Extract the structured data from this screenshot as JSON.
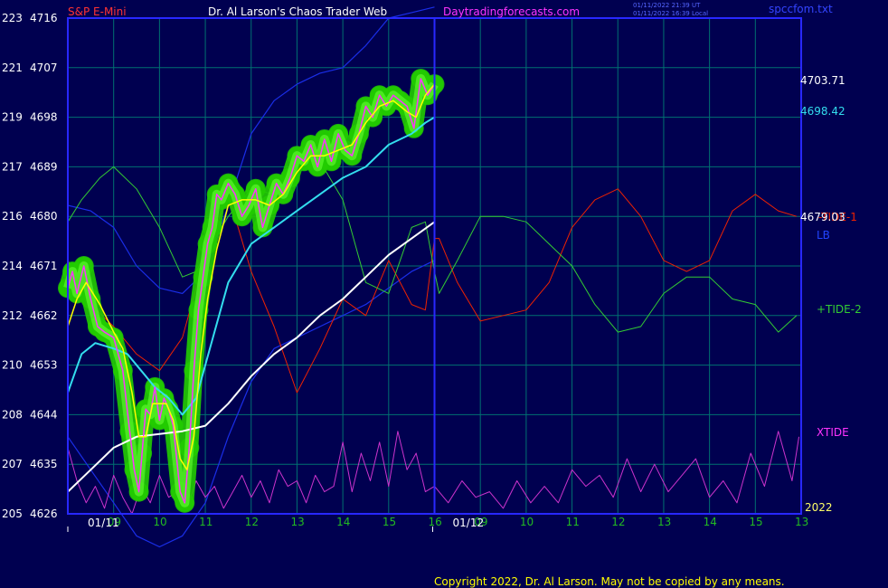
{
  "header": {
    "symbol": "S&P E-Mini",
    "title": "Dr. Al Larson's Chaos Trader Web",
    "site": "Daytradingforecasts.com",
    "utc_time": "01/11/2022 21:39 UT",
    "local_time": "01/11/2022 16:39 Local",
    "file": "spccfom.txt"
  },
  "footer": {
    "copyright": "Copyright 2022, Dr. Al Larson. May not be copied by any means."
  },
  "colors": {
    "background": "#000050",
    "frame": "#2828ff",
    "grid": "#007070",
    "price": "#ff33ff",
    "ma_fast": "#ffff00",
    "ma_mid": "#33ddee",
    "ma_slow": "#ffffff",
    "band": "#1a2ee8",
    "tide1": "#ee2200",
    "tide2": "#33cc33",
    "xtide": "#cc33cc",
    "halo": "#22cc00"
  },
  "chart_data": {
    "type": "line",
    "y_axis": {
      "left_ticks": [
        {
          "a": "223",
          "p": 4716
        },
        {
          "a": "221",
          "p": 4707
        },
        {
          "a": "219",
          "p": 4698
        },
        {
          "a": "217",
          "p": 4689
        },
        {
          "a": "216",
          "p": 4680
        },
        {
          "a": "214",
          "p": 4671
        },
        {
          "a": "212",
          "p": 4662
        },
        {
          "a": "210",
          "p": 4653
        },
        {
          "a": "208",
          "p": 4644
        },
        {
          "a": "207",
          "p": 4635
        },
        {
          "a": "205",
          "p": 4626
        }
      ],
      "ylim": [
        4626,
        4716
      ]
    },
    "x_axis": {
      "hour_labels": [
        "09",
        "10",
        "11",
        "12",
        "13",
        "14",
        "15",
        "16",
        "09",
        "10",
        "11",
        "12",
        "13",
        "14",
        "15",
        "13"
      ],
      "date_labels": [
        "01/11",
        "01/12"
      ],
      "right_corner_label": "2022",
      "hour_index_range": [
        8,
        24
      ],
      "day_separator_index": 16
    },
    "right_labels": {
      "price_last": "4703.71",
      "ma_mid_last": "4698.42",
      "ma_slow_last": "4679.03",
      "tide1": "-TIDE-1",
      "lb": "LB",
      "tide2": "+TIDE-2",
      "xtide": "XTIDE"
    },
    "series": [
      {
        "key": "price",
        "x": [
          8,
          8.1,
          8.2,
          8.35,
          8.5,
          8.65,
          8.8,
          9,
          9.2,
          9.35,
          9.45,
          9.55,
          9.62,
          9.7,
          9.8,
          9.9,
          10.0,
          10.1,
          10.2,
          10.3,
          10.45,
          10.55,
          10.65,
          10.75,
          10.85,
          10.95,
          11.05,
          11.15,
          11.25,
          11.35,
          11.5,
          11.65,
          11.8,
          11.95,
          12.1,
          12.25,
          12.4,
          12.55,
          12.7,
          12.85,
          13.0,
          13.15,
          13.3,
          13.45,
          13.6,
          13.75,
          13.9,
          14.05,
          14.2,
          14.35,
          14.5,
          14.65,
          14.8,
          14.95,
          15.1,
          15.25,
          15.4,
          15.55,
          15.7,
          15.85,
          16.0
        ],
        "values": [
          4667,
          4670,
          4666,
          4671,
          4665,
          4660,
          4659,
          4658,
          4652,
          4641,
          4634,
          4630,
          4637,
          4645,
          4644,
          4649,
          4643,
          4647,
          4645,
          4642,
          4630,
          4628,
          4638,
          4652,
          4663,
          4669,
          4675,
          4678,
          4684,
          4683,
          4686,
          4684,
          4680,
          4682,
          4685,
          4678,
          4682,
          4686,
          4684,
          4687,
          4691,
          4690,
          4693,
          4689,
          4694,
          4690,
          4695,
          4692,
          4691,
          4695,
          4700,
          4698,
          4702,
          4700,
          4702,
          4701,
          4700,
          4696,
          4705,
          4702,
          4704
        ]
      },
      {
        "key": "ma_fast",
        "x": [
          8,
          8.2,
          8.4,
          8.7,
          9,
          9.2,
          9.4,
          9.55,
          9.7,
          9.85,
          10.0,
          10.15,
          10.3,
          10.45,
          10.6,
          10.75,
          10.9,
          11.05,
          11.25,
          11.5,
          11.8,
          12.1,
          12.4,
          12.7,
          13.0,
          13.3,
          13.6,
          13.9,
          14.2,
          14.5,
          14.8,
          15.1,
          15.4,
          15.6,
          15.8,
          16.0
        ],
        "values": [
          4660,
          4665,
          4668,
          4664,
          4659,
          4656,
          4648,
          4640,
          4640,
          4646,
          4646,
          4646,
          4643,
          4636,
          4634,
          4640,
          4655,
          4665,
          4674,
          4682,
          4683,
          4683,
          4682,
          4684,
          4688,
          4691,
          4691,
          4692,
          4693,
          4697,
          4700,
          4701,
          4699,
          4698,
          4702,
          4704
        ]
      },
      {
        "key": "ma_mid",
        "x": [
          8,
          8.3,
          8.6,
          9,
          9.3,
          9.6,
          9.9,
          10.2,
          10.5,
          10.8,
          11.1,
          11.5,
          12.0,
          12.5,
          13.0,
          13.5,
          14.0,
          14.5,
          15.0,
          15.5,
          15.8,
          16.0
        ],
        "values": [
          4648,
          4655,
          4657,
          4656,
          4655,
          4652,
          4649,
          4647,
          4644,
          4647,
          4656,
          4668,
          4675,
          4678,
          4681,
          4684,
          4687,
          4689,
          4693,
          4695,
          4697,
          4698
        ]
      },
      {
        "key": "ma_slow",
        "x": [
          8,
          8.5,
          9,
          9.5,
          10,
          10.5,
          11,
          11.5,
          12,
          12.5,
          13,
          13.5,
          14,
          14.5,
          15,
          15.5,
          16
        ],
        "values": [
          4630,
          4634,
          4638,
          4640,
          4640.5,
          4641,
          4642,
          4646,
          4651,
          4655,
          4658,
          4662,
          4665,
          4669,
          4673,
          4676,
          4679
        ]
      },
      {
        "key": "band_upper",
        "x": [
          8,
          8.5,
          9,
          9.5,
          10,
          10.5,
          11,
          11.5,
          12,
          12.5,
          13,
          13.5,
          14,
          14.5,
          15,
          15.5,
          16
        ],
        "values": [
          4682,
          4681,
          4678,
          4671,
          4667,
          4666,
          4670,
          4682,
          4695,
          4701,
          4704,
          4706,
          4707,
          4711,
          4716,
          4717,
          4718
        ]
      },
      {
        "key": "band_lower",
        "x": [
          8,
          8.5,
          9,
          9.5,
          10,
          10.5,
          11,
          11.5,
          12,
          12.5,
          13,
          13.5,
          14,
          14.5,
          15,
          15.5,
          16
        ],
        "values": [
          4640,
          4634,
          4628,
          4622,
          4620,
          4622,
          4628,
          4640,
          4650,
          4656,
          4658,
          4660,
          4662,
          4664,
          4667,
          4670,
          4672
        ]
      },
      {
        "key": "tide1",
        "x": [
          8,
          8.5,
          9,
          9.5,
          10,
          10.5,
          10.8,
          11,
          11.5,
          12,
          12.5,
          13,
          13.5,
          14,
          14.5,
          15,
          15.5,
          15.8,
          16,
          16.1,
          16.5,
          17,
          17.5,
          18,
          18.5,
          19,
          19.5,
          20,
          20.5,
          21,
          21.5,
          22,
          22.5,
          23,
          23.5,
          23.9
        ],
        "values": [
          4672,
          4664,
          4660,
          4655,
          4652,
          4658,
          4667,
          4673,
          4684,
          4670,
          4660,
          4648,
          4656,
          4665,
          4662,
          4672,
          4664,
          4663,
          4676,
          4676,
          4668,
          4661,
          4662,
          4663,
          4668,
          4678,
          4683,
          4685,
          4680,
          4672,
          4670,
          4672,
          4681,
          4684,
          4681,
          4680
        ]
      },
      {
        "key": "tide2",
        "x": [
          8,
          8.3,
          8.7,
          9,
          9.5,
          10,
          10.5,
          10.8,
          11,
          11.5,
          12,
          12.5,
          13,
          13.5,
          14,
          14.5,
          15,
          15.5,
          15.8,
          16,
          16.1,
          16.5,
          17,
          17.5,
          18,
          18.5,
          19,
          19.5,
          20,
          20.5,
          21,
          21.5,
          22,
          22.5,
          23,
          23.5,
          23.9
        ],
        "values": [
          4679,
          4683,
          4687,
          4689,
          4685,
          4678,
          4669,
          4670,
          4673,
          4680,
          4685,
          4684,
          4690,
          4690,
          4683,
          4668,
          4666,
          4678,
          4679,
          4670,
          4666,
          4672,
          4680,
          4680,
          4679,
          4675,
          4671,
          4664,
          4659,
          4660,
          4666,
          4669,
          4669,
          4665,
          4664,
          4659,
          4662
        ]
      },
      {
        "key": "xtide",
        "x": [
          8,
          8.2,
          8.4,
          8.6,
          8.8,
          9.0,
          9.2,
          9.4,
          9.6,
          9.8,
          10.0,
          10.2,
          10.4,
          10.6,
          10.8,
          11.0,
          11.2,
          11.4,
          11.6,
          11.8,
          12.0,
          12.2,
          12.4,
          12.6,
          12.8,
          13.0,
          13.2,
          13.4,
          13.6,
          13.8,
          14.0,
          14.2,
          14.4,
          14.6,
          14.8,
          15.0,
          15.2,
          15.4,
          15.6,
          15.8,
          16.0,
          16.3,
          16.6,
          16.9,
          17.2,
          17.5,
          17.8,
          18.1,
          18.4,
          18.7,
          19.0,
          19.3,
          19.6,
          19.9,
          20.2,
          20.5,
          20.8,
          21.1,
          21.4,
          21.7,
          22.0,
          22.3,
          22.6,
          22.9,
          23.2,
          23.5,
          23.8,
          23.95
        ],
        "values": [
          4638,
          4632,
          4628,
          4631,
          4627,
          4633,
          4629,
          4626,
          4631,
          4628,
          4633,
          4629,
          4630,
          4627,
          4632,
          4629,
          4631,
          4627,
          4630,
          4633,
          4629,
          4632,
          4628,
          4634,
          4631,
          4632,
          4628,
          4633,
          4630,
          4631,
          4639,
          4630,
          4637,
          4632,
          4639,
          4631,
          4641,
          4634,
          4637,
          4630,
          4631,
          4628,
          4632,
          4629,
          4630,
          4627,
          4632,
          4628,
          4631,
          4628,
          4634,
          4631,
          4633,
          4629,
          4636,
          4630,
          4635,
          4630,
          4633,
          4636,
          4629,
          4632,
          4628,
          4637,
          4631,
          4641,
          4632,
          4640
        ]
      }
    ]
  }
}
